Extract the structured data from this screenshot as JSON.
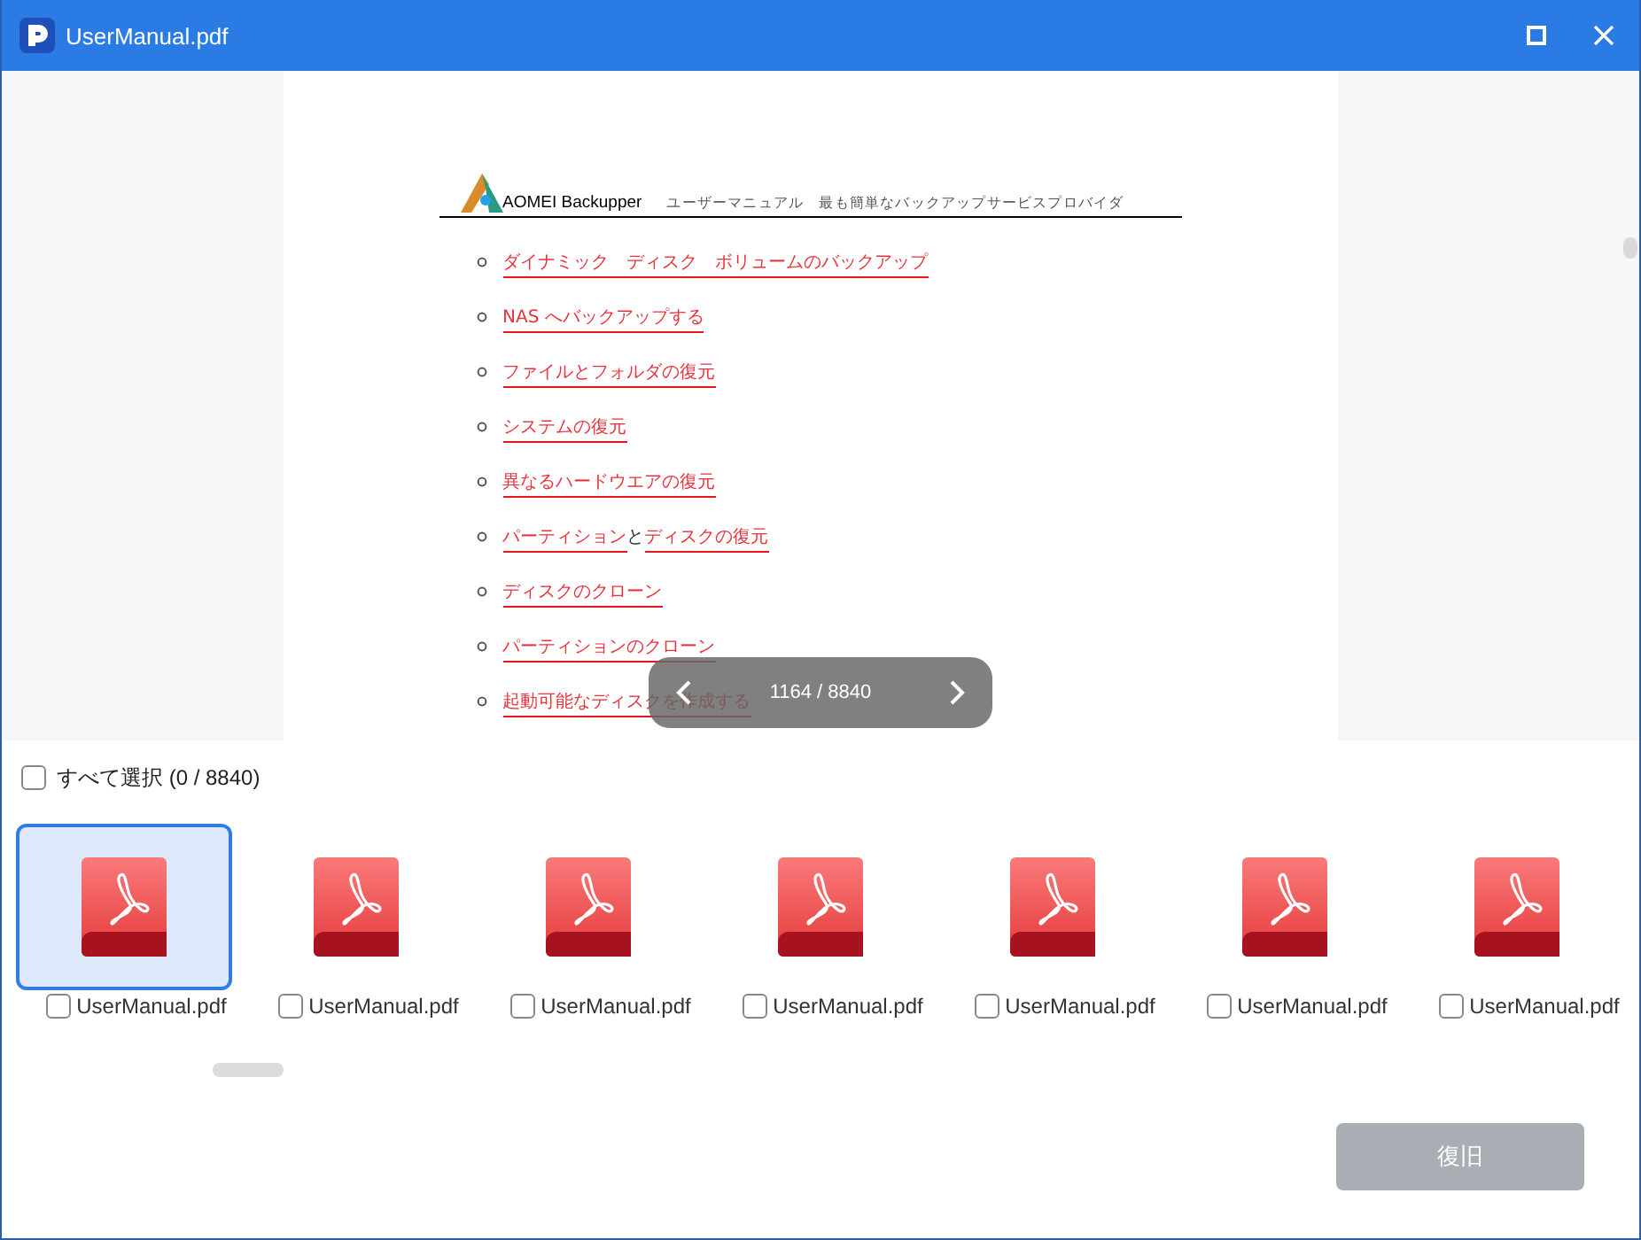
{
  "window": {
    "title": "UserManual.pdf"
  },
  "document": {
    "brand": "AOMEI Backupper",
    "subtitle": "ユーザーマニュアル　最も簡単なバックアップサービスプロバイダ",
    "items": [
      {
        "parts": [
          {
            "text": "ダイナミック　ディスク　ボリュームのバックアップ",
            "link": true
          }
        ]
      },
      {
        "parts": [
          {
            "text": "NAS へバックアップする",
            "link": true
          }
        ]
      },
      {
        "parts": [
          {
            "text": "ファイルとフォルダの復元",
            "link": true
          }
        ]
      },
      {
        "parts": [
          {
            "text": "システムの復元",
            "link": true
          }
        ]
      },
      {
        "parts": [
          {
            "text": "異なるハードウエアの復元",
            "link": true
          }
        ]
      },
      {
        "parts": [
          {
            "text": "パーティション",
            "link": true
          },
          {
            "text": "と",
            "link": false
          },
          {
            "text": "ディスクの復元",
            "link": true
          }
        ]
      },
      {
        "parts": [
          {
            "text": "ディスクのクローン",
            "link": true
          }
        ]
      },
      {
        "parts": [
          {
            "text": "パーティションのクローン",
            "link": true
          }
        ]
      },
      {
        "parts": [
          {
            "text": "起動可能なディスクを作成する",
            "link": true
          }
        ]
      }
    ]
  },
  "pager": {
    "text": "1164 / 8840"
  },
  "select_all": {
    "label": "すべて選択 (0 / 8840)",
    "checked": false
  },
  "files": [
    {
      "name": "UserManual.pdf",
      "selected": true,
      "checked": false
    },
    {
      "name": "UserManual.pdf",
      "selected": false,
      "checked": false
    },
    {
      "name": "UserManual.pdf",
      "selected": false,
      "checked": false
    },
    {
      "name": "UserManual.pdf",
      "selected": false,
      "checked": false
    },
    {
      "name": "UserManual.pdf",
      "selected": false,
      "checked": false
    },
    {
      "name": "UserManual.pdf",
      "selected": false,
      "checked": false
    },
    {
      "name": "UserManual.pdf",
      "selected": false,
      "checked": false
    }
  ],
  "restore_button": {
    "label": "復旧",
    "disabled": true
  }
}
